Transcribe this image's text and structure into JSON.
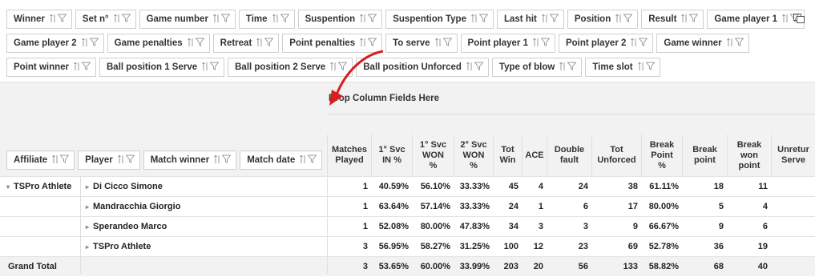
{
  "field_rows": [
    [
      "Winner",
      "Set n°",
      "Game number",
      "Time",
      "Suspention",
      "Suspention Type",
      "Last hit",
      "Position",
      "Result",
      "Game player 1"
    ],
    [
      "Game player 2",
      "Game penalties",
      "Retreat",
      "Point penalties",
      "To serve",
      "Point player 1",
      "Point player 2",
      "Game winner"
    ],
    [
      "Point winner",
      "Ball position 1 Serve",
      "Ball position 2 Serve",
      "Ball position Unforced",
      "Type of blow",
      "Time slot"
    ]
  ],
  "drop_hint": "Drop Column Fields Here",
  "row_fields": [
    "Affiliate",
    "Player",
    "Match winner",
    "Match date"
  ],
  "columns": [
    [
      "Matches",
      "Played"
    ],
    [
      "1° Svc",
      "IN %"
    ],
    [
      "1° Svc",
      "WON",
      "%"
    ],
    [
      "2° Svc",
      "WON",
      "%"
    ],
    [
      "Tot",
      "Win"
    ],
    [
      "ACE"
    ],
    [
      "Double",
      "fault"
    ],
    [
      "Tot",
      "Unforced"
    ],
    [
      "Break",
      "Point",
      "%"
    ],
    [
      "Break",
      "point"
    ],
    [
      "Break",
      "won",
      "point"
    ],
    [
      "Unretur",
      "Serve"
    ]
  ],
  "rows": [
    {
      "group": "TSPro Athlete",
      "player": "Di Cicco Simone",
      "values": [
        "1",
        "40.59%",
        "56.10%",
        "33.33%",
        "45",
        "4",
        "24",
        "38",
        "61.11%",
        "18",
        "11",
        ""
      ]
    },
    {
      "group": "",
      "player": "Mandracchia Giorgio",
      "values": [
        "1",
        "63.64%",
        "57.14%",
        "33.33%",
        "24",
        "1",
        "6",
        "17",
        "80.00%",
        "5",
        "4",
        ""
      ]
    },
    {
      "group": "",
      "player": "Sperandeo Marco",
      "values": [
        "1",
        "52.08%",
        "80.00%",
        "47.83%",
        "34",
        "3",
        "3",
        "9",
        "66.67%",
        "9",
        "6",
        ""
      ]
    },
    {
      "group": "",
      "player": "TSPro Athlete",
      "values": [
        "3",
        "56.95%",
        "58.27%",
        "31.25%",
        "100",
        "12",
        "23",
        "69",
        "52.78%",
        "36",
        "19",
        ""
      ]
    }
  ],
  "grand_total": {
    "label": "Grand Total",
    "values": [
      "3",
      "53.65%",
      "60.00%",
      "33.99%",
      "203",
      "20",
      "56",
      "133",
      "58.82%",
      "68",
      "40",
      ""
    ]
  },
  "colors": {
    "annotation_arrow": "#d81e1e",
    "band": "#f2f2f2"
  }
}
